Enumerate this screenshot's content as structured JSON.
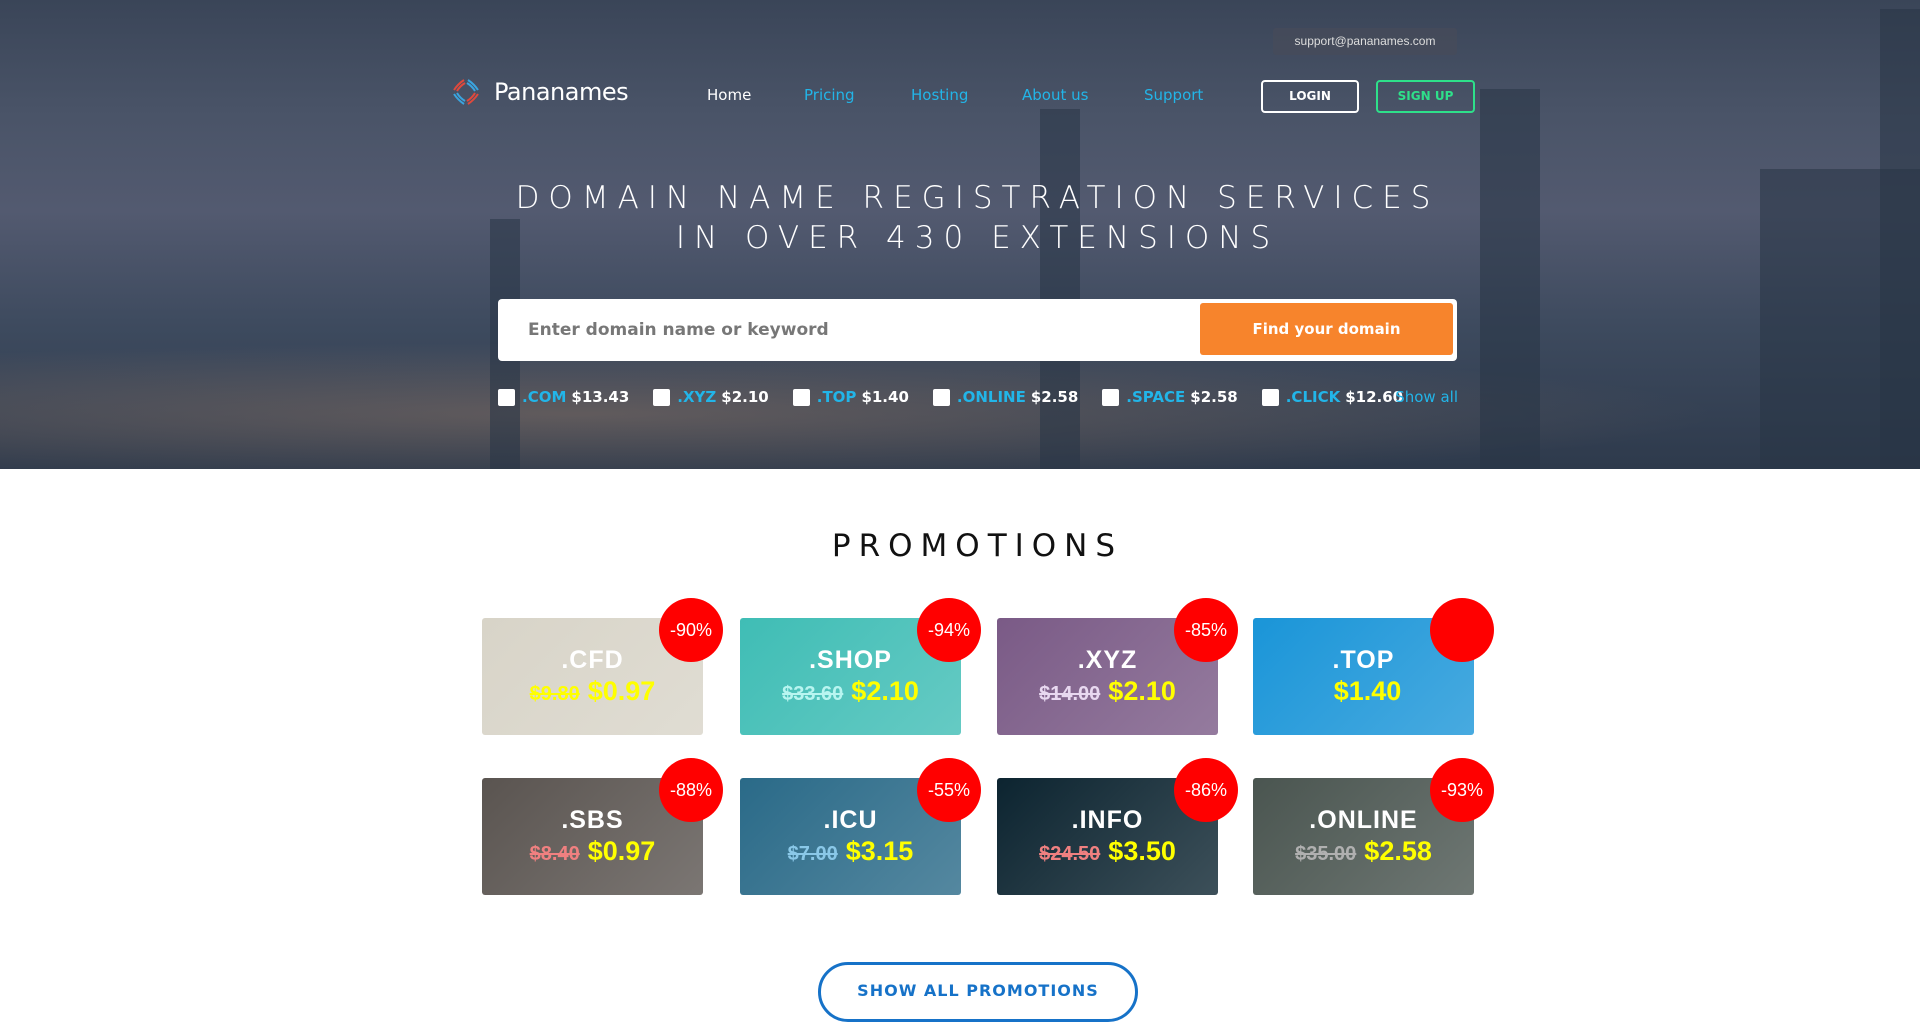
{
  "header": {
    "support_email": "support@pananames.com",
    "brand": "Pananames",
    "nav": [
      {
        "label": "Home",
        "color": "#ffffff"
      },
      {
        "label": "Pricing"
      },
      {
        "label": "Hosting"
      },
      {
        "label": "About us"
      },
      {
        "label": "Support"
      }
    ],
    "login": "LOGIN",
    "signup": "SIGN UP"
  },
  "hero": {
    "title_line1": "DOMAIN NAME REGISTRATION SERVICES",
    "title_line2": "IN OVER 430 EXTENSIONS",
    "search_placeholder": "Enter domain name or keyword",
    "search_button": "Find your domain",
    "extensions": [
      {
        "name": ".COM",
        "price": "$13.43"
      },
      {
        "name": ".XYZ",
        "price": "$2.10"
      },
      {
        "name": ".TOP",
        "price": "$1.40"
      },
      {
        "name": ".ONLINE",
        "price": "$2.58"
      },
      {
        "name": ".SPACE",
        "price": "$2.58"
      },
      {
        "name": ".CLICK",
        "price": "$12.60"
      }
    ],
    "show_all": "Show all"
  },
  "promotions": {
    "title": "PROMOTIONS",
    "show_all": "SHOW ALL PROMOTIONS",
    "cards": [
      {
        "tld": ".CFD",
        "old": "$9.80",
        "new": "$0.97",
        "discount": "-90%",
        "bg": "#d8d4c8",
        "old_color": "#ffff00"
      },
      {
        "tld": ".SHOP",
        "old": "$33.60",
        "new": "$2.10",
        "discount": "-94%",
        "bg": "#3fbdb5",
        "old_color": "#b8f5f0"
      },
      {
        "tld": ".XYZ",
        "old": "$14.00",
        "new": "$2.10",
        "discount": "-85%",
        "bg": "#7a5a86",
        "old_color": "#e8d8f0"
      },
      {
        "tld": ".TOP",
        "old": "",
        "new": "$1.40",
        "discount": "",
        "bg": "#1a95d8",
        "old_color": "#ffffff"
      },
      {
        "tld": ".SBS",
        "old": "$8.40",
        "new": "$0.97",
        "discount": "-88%",
        "bg": "#5a5450",
        "old_color": "#f08080"
      },
      {
        "tld": ".ICU",
        "old": "$7.00",
        "new": "$3.15",
        "discount": "-55%",
        "bg": "#2a6a88",
        "old_color": "#8ac8e8"
      },
      {
        "tld": ".INFO",
        "old": "$24.50",
        "new": "$3.50",
        "discount": "-86%",
        "bg": "#0c2430",
        "old_color": "#f08080"
      },
      {
        "tld": ".ONLINE",
        "old": "$35.00",
        "new": "$2.58",
        "discount": "-93%",
        "bg": "#4a5550",
        "old_color": "#b0b0b0"
      }
    ]
  }
}
